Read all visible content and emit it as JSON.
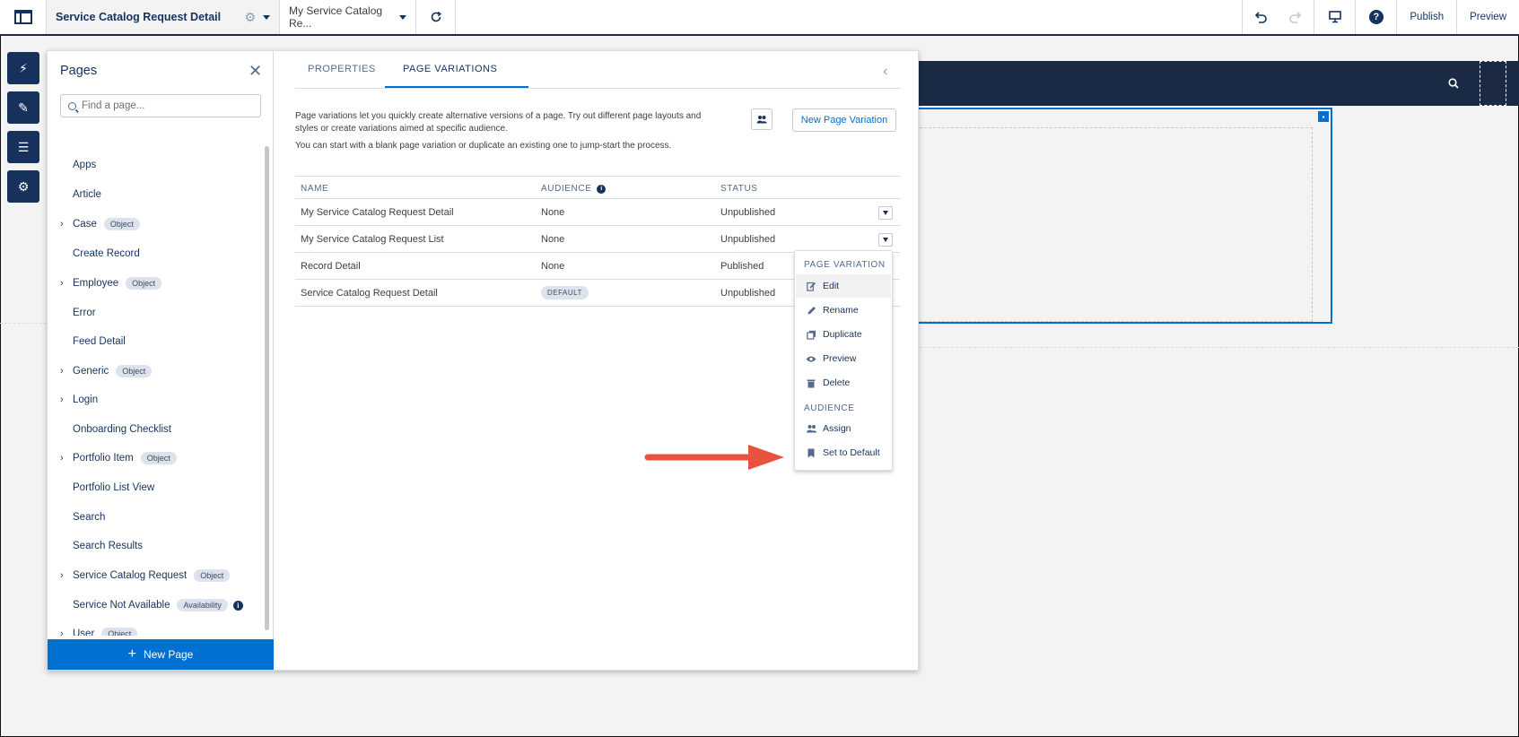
{
  "topbar": {
    "title": "Service Catalog Request Detail",
    "variant": "My Service Catalog Re...",
    "publish": "Publish",
    "preview": "Preview",
    "help": "?"
  },
  "pages_panel": {
    "heading": "Pages",
    "search_placeholder": "Find a page...",
    "items": [
      {
        "label": "Apps",
        "expandable": false
      },
      {
        "label": "Article",
        "expandable": false
      },
      {
        "label": "Case",
        "expandable": true,
        "badge": "Object"
      },
      {
        "label": "Create Record",
        "expandable": false
      },
      {
        "label": "Employee",
        "expandable": true,
        "badge": "Object"
      },
      {
        "label": "Error",
        "expandable": false
      },
      {
        "label": "Feed Detail",
        "expandable": false
      },
      {
        "label": "Generic",
        "expandable": true,
        "badge": "Object"
      },
      {
        "label": "Login",
        "expandable": true
      },
      {
        "label": "Onboarding Checklist",
        "expandable": false
      },
      {
        "label": "Portfolio Item",
        "expandable": true,
        "badge": "Object"
      },
      {
        "label": "Portfolio List View",
        "expandable": false
      },
      {
        "label": "Search",
        "expandable": false
      },
      {
        "label": "Search Results",
        "expandable": false
      },
      {
        "label": "Service Catalog Request",
        "expandable": true,
        "badge": "Object"
      },
      {
        "label": "Service Not Available",
        "expandable": false,
        "badge": "Availability",
        "info": true
      },
      {
        "label": "User",
        "expandable": true,
        "badge": "Object"
      }
    ],
    "new_page": "New Page"
  },
  "content": {
    "tabs": [
      {
        "label": "PROPERTIES",
        "active": false
      },
      {
        "label": "PAGE VARIATIONS",
        "active": true
      }
    ],
    "description_1": "Page variations let you quickly create alternative versions of a page. Try out different page layouts and styles or create variations aimed at specific audience.",
    "description_2": "You can start with a blank page variation or duplicate an existing one to jump-start the process.",
    "new_variation_button": "New Page Variation",
    "table": {
      "headers": [
        "NAME",
        "AUDIENCE",
        "STATUS"
      ],
      "rows": [
        {
          "name": "My Service Catalog Request Detail",
          "audience": "None",
          "status": "Unpublished",
          "menu": true
        },
        {
          "name": "My Service Catalog Request List",
          "audience": "None",
          "status": "Unpublished",
          "menu": true
        },
        {
          "name": "Record Detail",
          "audience": "None",
          "status": "Published",
          "menu": false
        },
        {
          "name": "Service Catalog Request Detail",
          "audience_badge": "DEFAULT",
          "status": "Unpublished",
          "menu": false
        }
      ]
    }
  },
  "dropdown": {
    "section_1": "PAGE VARIATION",
    "items_1": [
      {
        "label": "Edit",
        "icon": "edit-icon"
      },
      {
        "label": "Rename",
        "icon": "pencil-icon"
      },
      {
        "label": "Duplicate",
        "icon": "copy-icon"
      },
      {
        "label": "Preview",
        "icon": "eye-icon"
      },
      {
        "label": "Delete",
        "icon": "trash-icon"
      }
    ],
    "section_2": "AUDIENCE",
    "items_2": [
      {
        "label": "Assign",
        "icon": "people-icon"
      },
      {
        "label": "Set to Default",
        "icon": "bookmark-icon"
      }
    ]
  },
  "colors": {
    "brand_blue": "#0070d2",
    "navy": "#16325c",
    "annotation_arrow": "#e8533f"
  }
}
